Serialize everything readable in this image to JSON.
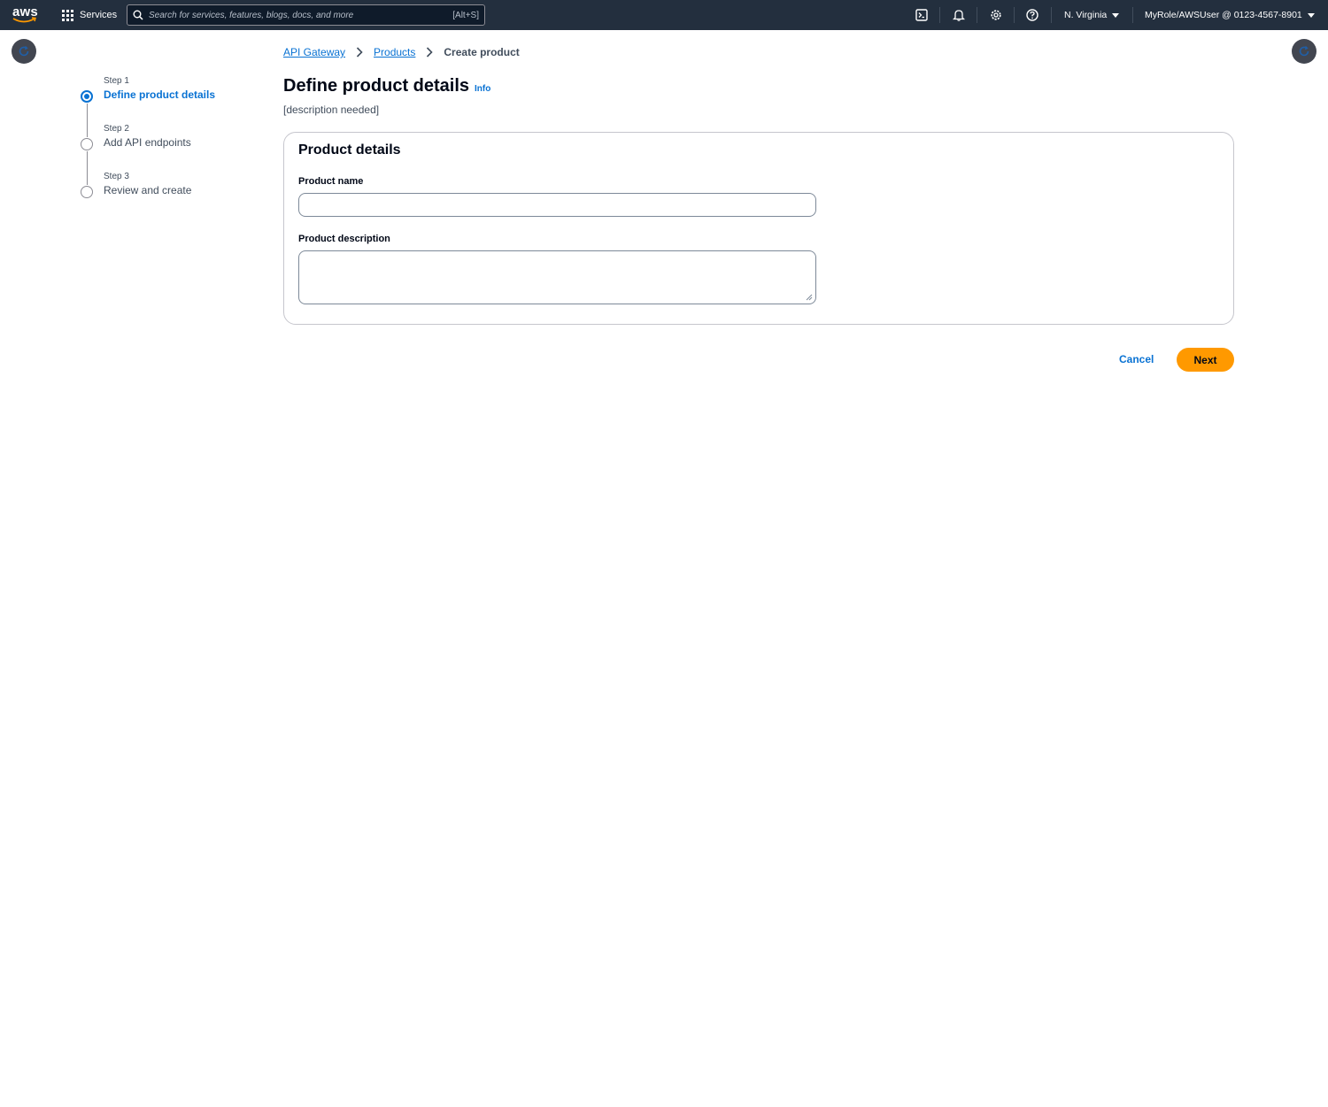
{
  "topnav": {
    "logo_text": "aws",
    "services_label": "Services",
    "search_placeholder": "Search for services, features, blogs, docs, and more",
    "search_shortcut": "[Alt+S]",
    "region_label": "N. Virginia",
    "account_label": "MyRole/AWSUser @ 0123-4567-8901",
    "icons": [
      "cloudshell-icon",
      "notifications-icon",
      "settings-icon",
      "help-icon"
    ]
  },
  "steps": [
    {
      "number": "Step 1",
      "label": "Define product details",
      "active": true
    },
    {
      "number": "Step 2",
      "label": "Add API endpoints",
      "active": false
    },
    {
      "number": "Step 3",
      "label": "Review and create",
      "active": false
    }
  ],
  "breadcrumb": {
    "items": [
      "API Gateway",
      "Products"
    ],
    "current": "Create product"
  },
  "page": {
    "title": "Define product details",
    "info_label": "Info",
    "description": "[description needed]"
  },
  "panel": {
    "title": "Product details",
    "product_name_label": "Product name",
    "product_name_value": "",
    "product_description_label": "Product description",
    "product_description_value": ""
  },
  "actions": {
    "cancel_label": "Cancel",
    "next_label": "Next"
  },
  "colors": {
    "nav_bg": "#232f3e",
    "link": "#0972d3",
    "primary_button": "#ff9900"
  }
}
